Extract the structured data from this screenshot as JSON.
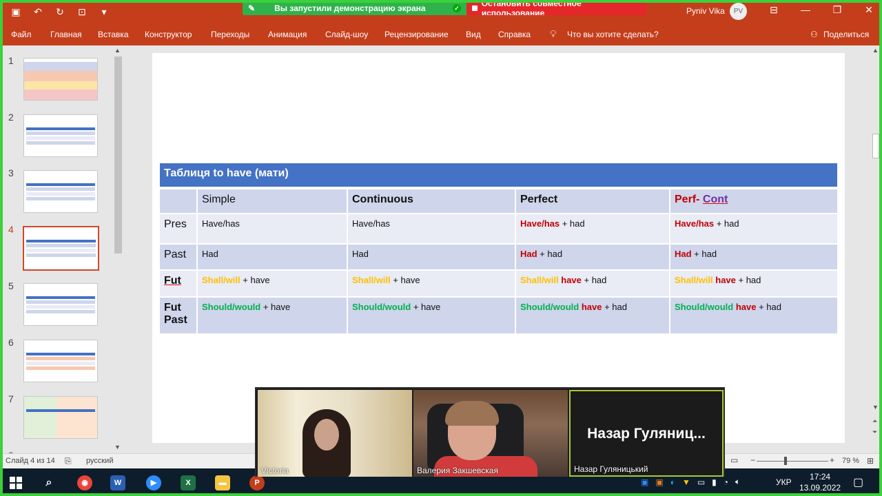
{
  "window": {
    "share_banner": "Вы запустили демонстрацию экрана",
    "stop_share": "Остановить совместное использование",
    "user_name": "Pyniv Vika",
    "user_initials": "PV"
  },
  "ribbon": {
    "tabs": [
      "Файл",
      "Главная",
      "Вставка",
      "Конструктор",
      "Переходы",
      "Анимация",
      "Слайд-шоу",
      "Рецензирование",
      "Вид",
      "Справка"
    ],
    "tell_me": "Что вы хотите сделать?",
    "share": "Поделиться"
  },
  "thumbnails": [
    "1",
    "2",
    "3",
    "4",
    "5",
    "6",
    "7",
    "8"
  ],
  "active_slide": 4,
  "slide": {
    "title": "Таблиця to have (мати)",
    "headers": [
      "",
      "Simple",
      "Continuous",
      "Perfect",
      "Perf- ",
      "Cont"
    ],
    "rows": [
      {
        "label": "Pres",
        "simple": "Have/has",
        "continuous": "Have/has",
        "perfect_a": "Have/has",
        "perfect_b": " + had",
        "perfcont_a": "Have/has",
        "perfcont_b": " + had"
      },
      {
        "label": "Past",
        "simple": "Had",
        "continuous": "Had",
        "perfect_a": "Had",
        "perfect_b": " + had",
        "perfcont_a": "Had",
        "perfcont_b": " + had"
      },
      {
        "label": "Fut",
        "simple_a": "Shall/will",
        "simple_b": " + have",
        "continuous_a": "Shall/will",
        "continuous_b": " + have",
        "perfect_a": "Shall/will ",
        "perfect_b": "have",
        "perfect_c": " + had",
        "perfcont_a": "Shall/will ",
        "perfcont_b": "have",
        "perfcont_c": " + had"
      },
      {
        "label_1": "Fut",
        "label_2": "Past",
        "simple_a": "Should/would",
        "simple_b": " + have",
        "continuous_a": "Should/would",
        "continuous_b": " + have",
        "perfect_a": "Should/would ",
        "perfect_b": "have",
        "perfect_c": " + had",
        "perfcont_a": "Should/would ",
        "perfcont_b": "have",
        "perfcont_c": " + had"
      }
    ]
  },
  "status": {
    "slide_info": "Слайд 4 из 14",
    "language": "русский",
    "zoom": "79 %"
  },
  "video": {
    "p1": "Victoria",
    "p2": "Валерия Закшевская",
    "p3_big": "Назар  Гуляниц...",
    "p3": "Назар Гуляницький"
  },
  "taskbar": {
    "lang": "УКР",
    "time": "17:24",
    "date": "13.09.2022"
  },
  "colors": {
    "ppt_red": "#c43e1c",
    "table_header": "#4472c4",
    "share_green": "#2fb24c",
    "stop_red": "#e5262a"
  }
}
